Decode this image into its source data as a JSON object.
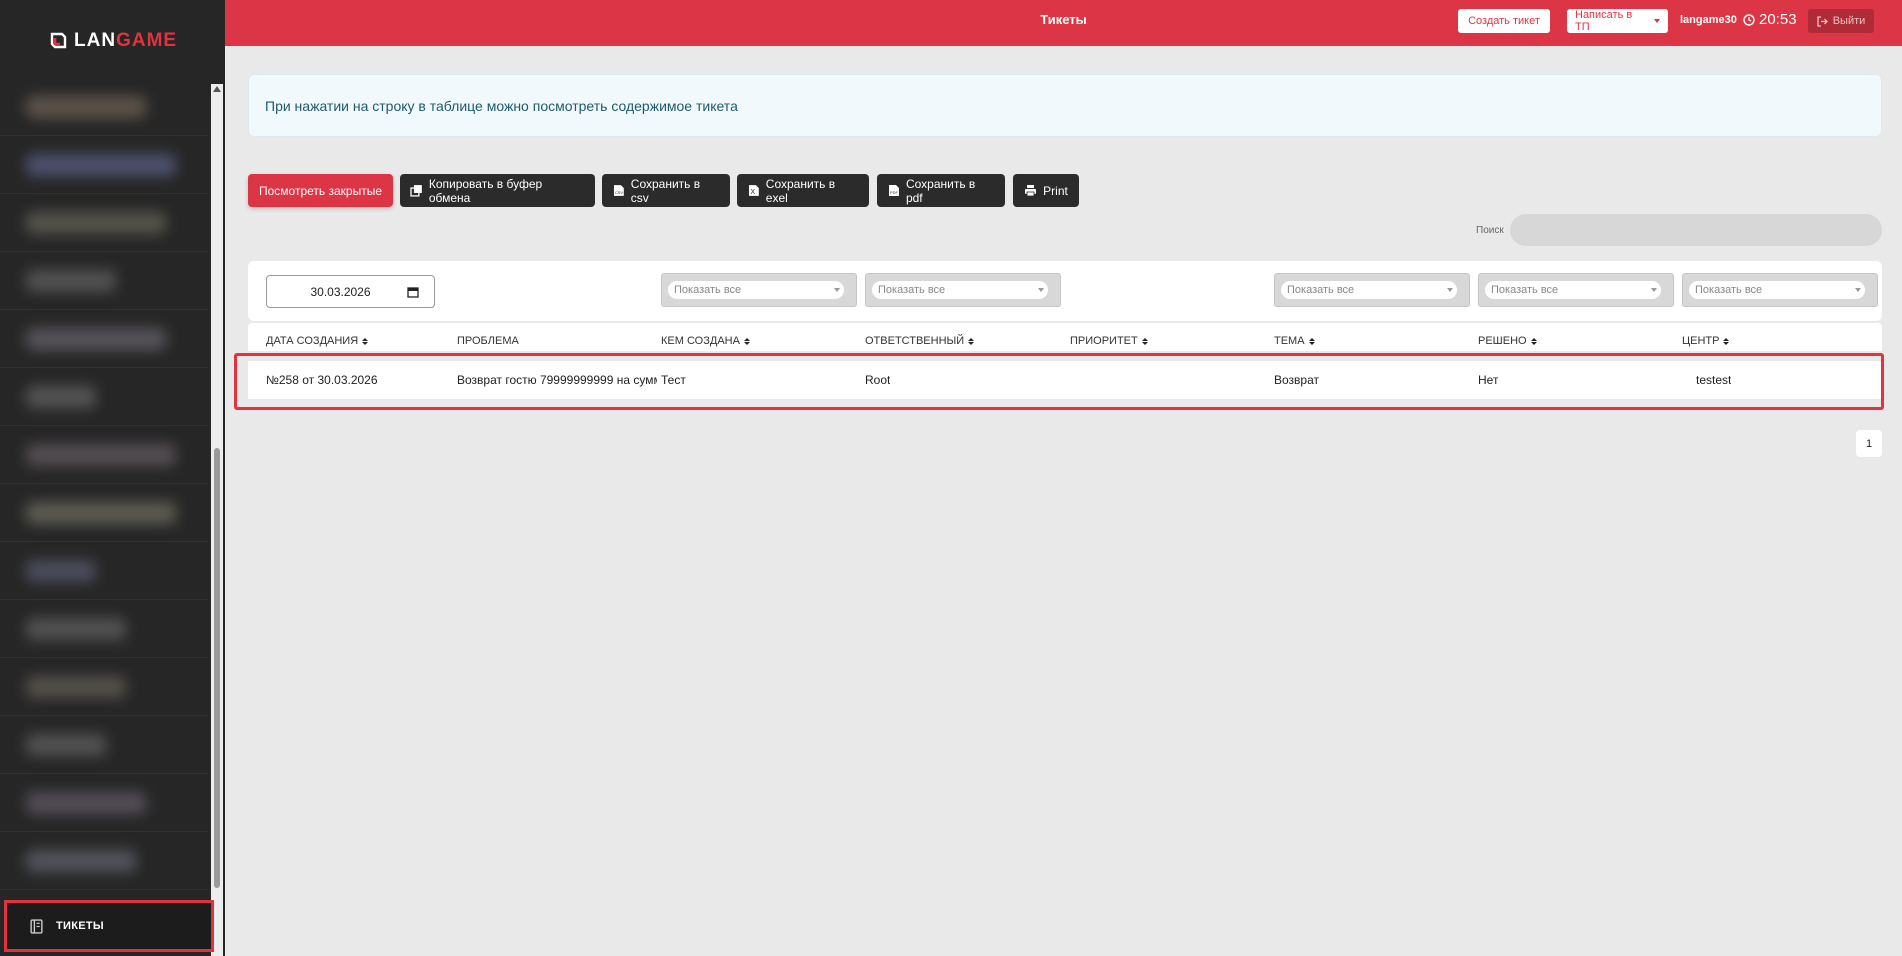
{
  "brand": {
    "logo_lan": "LAN",
    "logo_game": "GAME"
  },
  "topbar": {
    "title": "Тикеты",
    "create_ticket": "Создать тикет",
    "write_tp": "Написать в ТП",
    "user": "langame30",
    "time": "20:53",
    "logout": "Выйти"
  },
  "sidebar": {
    "active_item": "ТИКЕТЫ"
  },
  "info": {
    "text": "При нажатии на строку в таблице можно посмотреть содержимое тикета"
  },
  "toolbar": {
    "show_closed": "Посмотреть закрытые",
    "copy": "Копировать в буфер обмена",
    "csv": "Сохранить в csv",
    "excel": "Сохранить в exel",
    "pdf": "Сохранить в pdf",
    "print": "Print"
  },
  "search": {
    "label": "Поиск",
    "value": ""
  },
  "filters": {
    "date": "30.03.2026",
    "select_placeholder": "Показать все"
  },
  "table": {
    "headers": [
      "ДАТА СОЗДАНИЯ",
      "ПРОБЛЕМА",
      "КЕМ СОЗДАНА",
      "ОТВЕТСТВЕННЫЙ",
      "ПРИОРИТЕТ",
      "ТЕМА",
      "РЕШЕНО",
      "ЦЕНТР"
    ],
    "rows": [
      {
        "date": "№258 от 30.03.2026",
        "problem": "Возврат гостю 79999999999 на сумм",
        "created_by": "Тест",
        "responsible": "Root",
        "priority": "",
        "topic": "Возврат",
        "solved": "Нет",
        "center": "testest"
      }
    ]
  },
  "pagination": {
    "current": "1"
  },
  "colors": {
    "accent": "#dc3545",
    "sidebar": "#262626",
    "highlight": "#e0323f"
  }
}
